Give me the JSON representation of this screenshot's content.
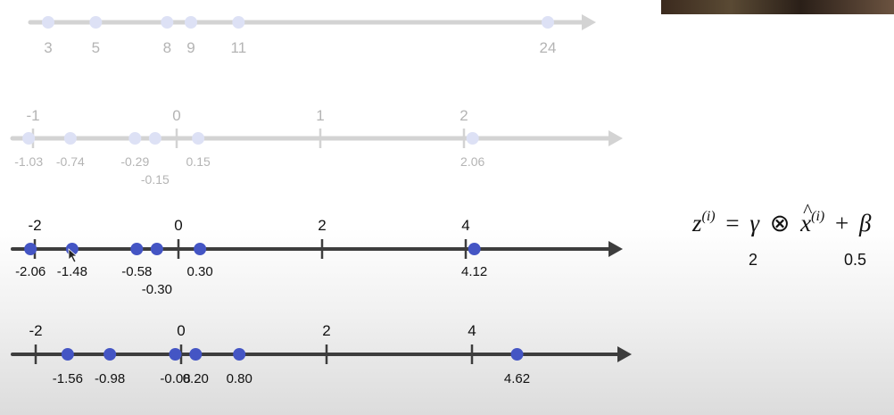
{
  "number_lines": [
    {
      "id": "raw-values",
      "style": "faded",
      "axis_ticks": [],
      "points": [
        {
          "value": 3,
          "label": "3"
        },
        {
          "value": 5,
          "label": "5"
        },
        {
          "value": 8,
          "label": "8"
        },
        {
          "value": 9,
          "label": "9"
        },
        {
          "value": 11,
          "label": "11"
        },
        {
          "value": 24,
          "label": "24"
        }
      ]
    },
    {
      "id": "normalized-values",
      "style": "faded",
      "axis_ticks": [
        {
          "value": -1,
          "label": "-1"
        },
        {
          "value": 0,
          "label": "0"
        },
        {
          "value": 1,
          "label": "1"
        },
        {
          "value": 2,
          "label": "2"
        }
      ],
      "points": [
        {
          "value": -1.03,
          "label": "-1.03"
        },
        {
          "value": -0.74,
          "label": "-0.74"
        },
        {
          "value": -0.29,
          "label": "-0.29"
        },
        {
          "value": -0.15,
          "label": "-0.15"
        },
        {
          "value": 0.15,
          "label": "0.15"
        },
        {
          "value": 2.06,
          "label": "2.06"
        }
      ]
    },
    {
      "id": "scaled-values",
      "style": "active",
      "axis_ticks": [
        {
          "value": -2,
          "label": "-2"
        },
        {
          "value": 0,
          "label": "0"
        },
        {
          "value": 2,
          "label": "2"
        },
        {
          "value": 4,
          "label": "4"
        }
      ],
      "points": [
        {
          "value": -2.06,
          "label": "-2.06"
        },
        {
          "value": -1.48,
          "label": "-1.48"
        },
        {
          "value": -0.58,
          "label": "-0.58"
        },
        {
          "value": -0.3,
          "label": "-0.30"
        },
        {
          "value": 0.3,
          "label": "0.30"
        },
        {
          "value": 4.12,
          "label": "4.12"
        }
      ]
    },
    {
      "id": "shifted-values",
      "style": "active",
      "axis_ticks": [
        {
          "value": -2,
          "label": "-2"
        },
        {
          "value": 0,
          "label": "0"
        },
        {
          "value": 2,
          "label": "2"
        },
        {
          "value": 4,
          "label": "4"
        }
      ],
      "points": [
        {
          "value": -1.56,
          "label": "-1.56"
        },
        {
          "value": -0.98,
          "label": "-0.98"
        },
        {
          "value": -0.08,
          "label": "-0.08"
        },
        {
          "value": 0.2,
          "label": "0.20"
        },
        {
          "value": 0.8,
          "label": "0.80"
        },
        {
          "value": 4.62,
          "label": "4.62"
        }
      ]
    }
  ],
  "formula": {
    "lhs": "z",
    "superscript": "(i)",
    "equals": "=",
    "gamma": "γ",
    "otimes": "⊗",
    "xhat": "x",
    "plus": "+",
    "beta": "β",
    "gamma_value": "2",
    "beta_value": "0.5"
  },
  "colors": {
    "faded_line": "#d3d3d3",
    "faded_point": "#dde1f5",
    "faded_text": "#b4b4b4",
    "active_line": "#3d3d3d",
    "active_point": "#4455c4",
    "active_text": "#111111"
  }
}
